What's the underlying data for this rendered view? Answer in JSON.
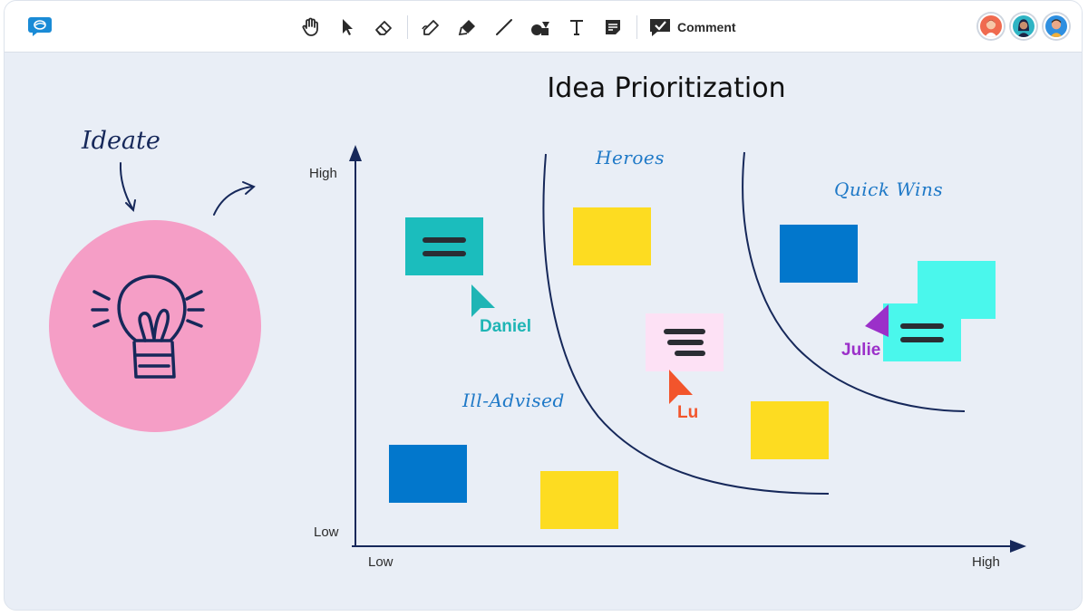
{
  "toolbar": {
    "tools": [
      "hand-icon",
      "pointer-icon",
      "eraser-icon",
      "pen-icon",
      "highlighter-icon",
      "line-icon",
      "shapes-icon",
      "text-icon",
      "sticky-note-icon"
    ],
    "comment_label": "Comment"
  },
  "board": {
    "title": "Idea Prioritization",
    "ideate_label": "Ideate",
    "y_axis": {
      "high": "High",
      "low": "Low"
    },
    "x_axis": {
      "low": "Low",
      "high": "High"
    },
    "zones": {
      "heroes": "Heroes",
      "quick_wins": "Quick Wins",
      "ill_advised": "Ill-Advised"
    },
    "cursors": {
      "daniel": {
        "name": "Daniel",
        "color": "#1fb5b5"
      },
      "lu": {
        "name": "Lu",
        "color": "#f2552c"
      },
      "julie": {
        "name": "Julie",
        "color": "#9b30c9"
      }
    }
  },
  "colors": {
    "yellow": "#fddc21",
    "blue": "#0277cc",
    "teal": "#1bbdbd",
    "cyan": "#4af7ec",
    "pink_note": "#fde1f5",
    "circle": "#f59ec6",
    "ink": "#16285a"
  }
}
